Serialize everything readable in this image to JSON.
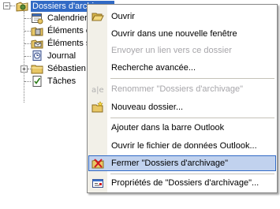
{
  "tree": {
    "root": {
      "label": "Dossiers d'archivage",
      "expanded": true,
      "selected": true
    },
    "children": [
      {
        "label": "Calendrier",
        "icon": "calendar-icon"
      },
      {
        "label": "Éléments e",
        "icon": "deleted-items-icon"
      },
      {
        "label": "Éléments s",
        "icon": "sent-items-icon"
      },
      {
        "label": "Journal",
        "icon": "journal-icon"
      },
      {
        "label": "Sébastien",
        "icon": "folder-icon",
        "has_children": true
      },
      {
        "label": "Tâches",
        "icon": "tasks-icon"
      }
    ]
  },
  "menu": {
    "items": [
      {
        "label": "Ouvrir",
        "icon": "open-folder-icon",
        "enabled": true
      },
      {
        "label": "Ouvrir dans une nouvelle fenêtre",
        "enabled": true
      },
      {
        "label": "Envoyer un lien vers ce dossier",
        "enabled": false
      },
      {
        "label": "Recherche avancée...",
        "enabled": true
      },
      {
        "label": "Renommer \"Dossiers d'archivage\"",
        "icon": "rename-icon",
        "enabled": false
      },
      {
        "label": "Nouveau dossier...",
        "icon": "new-folder-icon",
        "enabled": true
      },
      {
        "label": "Ajouter dans la barre Outlook",
        "enabled": true
      },
      {
        "label": "Ouvrir le fichier de données Outlook...",
        "enabled": true
      },
      {
        "label": "Fermer \"Dossiers d'archivage\"",
        "icon": "close-folder-icon",
        "enabled": true,
        "highlighted": true
      },
      {
        "label": "Propriétés de \"Dossiers d'archivage\"...",
        "icon": "properties-icon",
        "enabled": true
      }
    ]
  },
  "colors": {
    "selection": "#316ac5",
    "menu_highlight": "#c1d2ee",
    "menu_gutter": "#f2f0e8",
    "disabled_text": "#a7a6aa"
  }
}
